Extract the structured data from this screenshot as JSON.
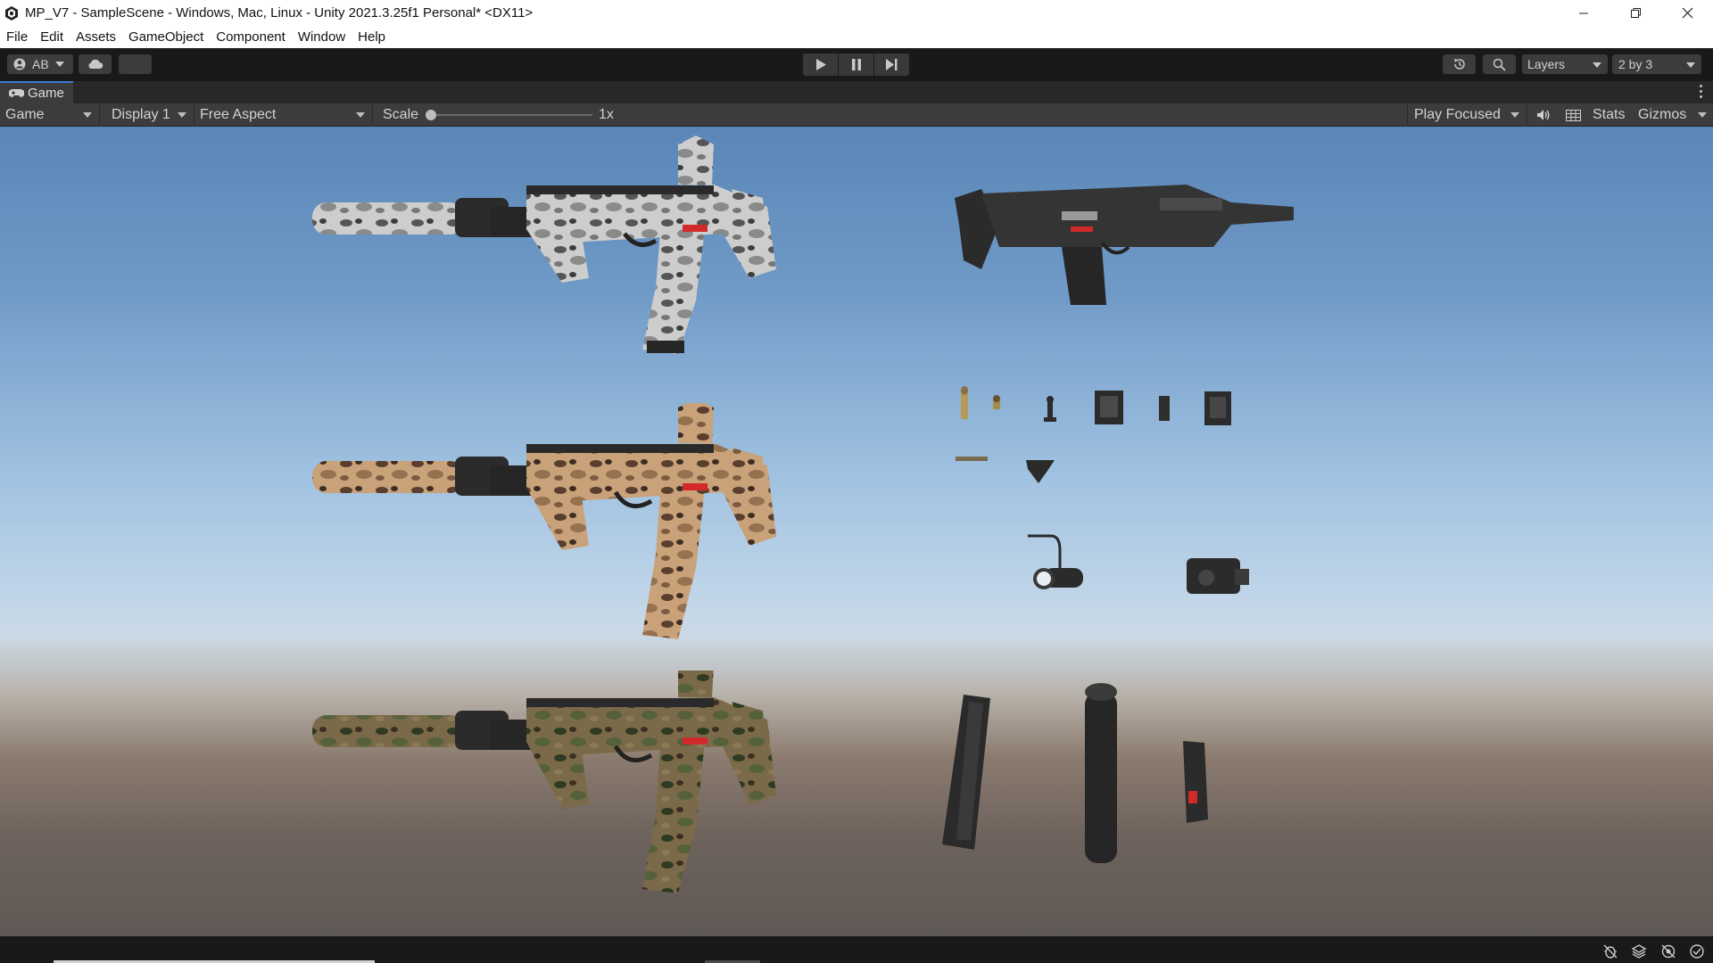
{
  "window": {
    "title": "MP_V7 - SampleScene - Windows, Mac, Linux - Unity 2021.3.25f1 Personal* <DX11>"
  },
  "menu": [
    "File",
    "Edit",
    "Assets",
    "GameObject",
    "Component",
    "Window",
    "Help"
  ],
  "toolbar": {
    "account_label": "AB",
    "layers_label": "Layers",
    "layout_label": "2 by 3"
  },
  "tab": {
    "label": "Game"
  },
  "game_toolbar": {
    "mode": "Game",
    "display": "Display 1",
    "aspect": "Free Aspect",
    "scale_label": "Scale",
    "scale_value": "1x",
    "scale_fraction": 0.0,
    "play_mode": "Play Focused",
    "stats_label": "Stats",
    "gizmos_label": "Gizmos"
  },
  "scene": {
    "rifles": [
      {
        "name": "snow-camo",
        "body": "#c9c9c9",
        "spot1": "#5a5a5a",
        "spot2": "#8e8e8e"
      },
      {
        "name": "desert-camo",
        "body": "#c8a27a",
        "spot1": "#5a4030",
        "spot2": "#9a7656"
      },
      {
        "name": "woodland-camo",
        "body": "#7a6a4a",
        "spot1": "#2f3a22",
        "spot2": "#55613a"
      }
    ],
    "colors": {
      "gun_dark": "#2a2a2a",
      "accent_red": "#d22a2a"
    }
  }
}
